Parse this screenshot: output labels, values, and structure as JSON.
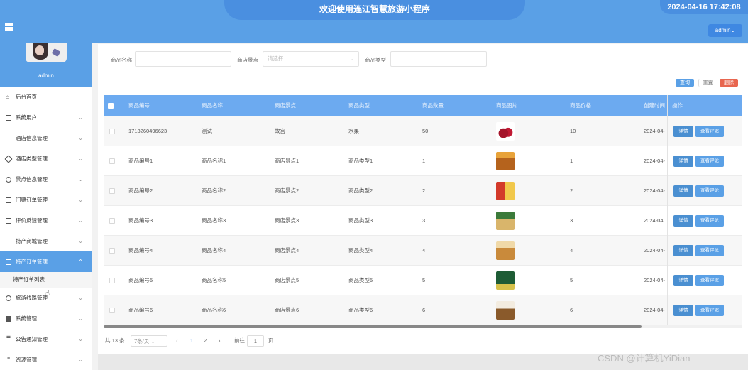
{
  "header": {
    "title": "欢迎使用连江智慧旅游小程序",
    "datetime": "2024-04-16 17:42:08",
    "user_button": "admin⌄"
  },
  "sidebar": {
    "profile_name": "admin",
    "items": [
      {
        "label": "后台首页",
        "icon": "home-icon"
      },
      {
        "label": "系统用户",
        "icon": "monitor-icon"
      },
      {
        "label": "酒店信息管理",
        "icon": "bookmark-icon"
      },
      {
        "label": "酒店类型管理",
        "icon": "tag-icon"
      },
      {
        "label": "景点信息管理",
        "icon": "gear-icon"
      },
      {
        "label": "门票订单管理",
        "icon": "ticket-icon"
      },
      {
        "label": "评价反馈管理",
        "icon": "document-icon"
      },
      {
        "label": "特产商城管理",
        "icon": "shop-icon"
      },
      {
        "label": "特产订单管理",
        "icon": "order-icon"
      },
      {
        "label": "旅游线路管理",
        "icon": "route-icon"
      },
      {
        "label": "系统管理",
        "icon": "chat-icon"
      },
      {
        "label": "公告通知管理",
        "icon": "notice-icon"
      },
      {
        "label": "资源管理",
        "icon": "list-icon"
      }
    ],
    "submenu": {
      "label": "特产订单列表"
    }
  },
  "filters": {
    "name_label": "商品名称",
    "spot_label": "商店景点",
    "spot_placeholder": "请选择",
    "type_label": "商品类型"
  },
  "actions": {
    "query": "查询",
    "reset": "重置",
    "delete": "删除"
  },
  "colors": {
    "header": "#5aa0e6",
    "table_head": "#6caaf0",
    "delete": "#e8664f",
    "detail_btn": "#4a8fd1"
  },
  "table": {
    "columns": [
      "商品编号",
      "商品名称",
      "商店景点",
      "商品类型",
      "商品数量",
      "商品图片",
      "商品价格",
      "创建时间",
      "操作"
    ],
    "rows": [
      {
        "id": "1713260496623",
        "name": "测试",
        "spot": "故宫",
        "type": "水果",
        "qty": "50",
        "price": "10",
        "created": "2024-04-",
        "img": "cherry"
      },
      {
        "id": "商品编号1",
        "name": "商品名称1",
        "spot": "商店景点1",
        "type": "商品类型1",
        "qty": "1",
        "price": "1",
        "created": "2024-04-",
        "img": "snack1"
      },
      {
        "id": "商品编号2",
        "name": "商品名称2",
        "spot": "商店景点2",
        "type": "商品类型2",
        "qty": "2",
        "price": "2",
        "created": "2024-04-",
        "img": "snack2"
      },
      {
        "id": "商品编号3",
        "name": "商品名称3",
        "spot": "商店景点3",
        "type": "商品类型3",
        "qty": "3",
        "price": "3",
        "created": "2024-04",
        "img": "snack3"
      },
      {
        "id": "商品编号4",
        "name": "商品名称4",
        "spot": "商店景点4",
        "type": "商品类型4",
        "qty": "4",
        "price": "4",
        "created": "2024-04-",
        "img": "snack4"
      },
      {
        "id": "商品编号5",
        "name": "商品名称5",
        "spot": "商店景点5",
        "type": "商品类型5",
        "qty": "5",
        "price": "5",
        "created": "2024-04-",
        "img": "snack5"
      },
      {
        "id": "商品编号6",
        "name": "商品名称6",
        "spot": "商店景点6",
        "type": "商品类型6",
        "qty": "6",
        "price": "6",
        "created": "2024-04-",
        "img": "snack6"
      }
    ],
    "row_buttons": {
      "detail": "详情",
      "review": "查看评论"
    }
  },
  "pagination": {
    "total": "共 13 条",
    "page_size": "7条/页",
    "pages": [
      "1",
      "2"
    ],
    "current": "1",
    "goto_label": "前往",
    "goto_value": "1",
    "page_suffix": "页",
    "prev": "‹",
    "next": "›"
  },
  "watermark": "CSDN @计算机YiDian"
}
